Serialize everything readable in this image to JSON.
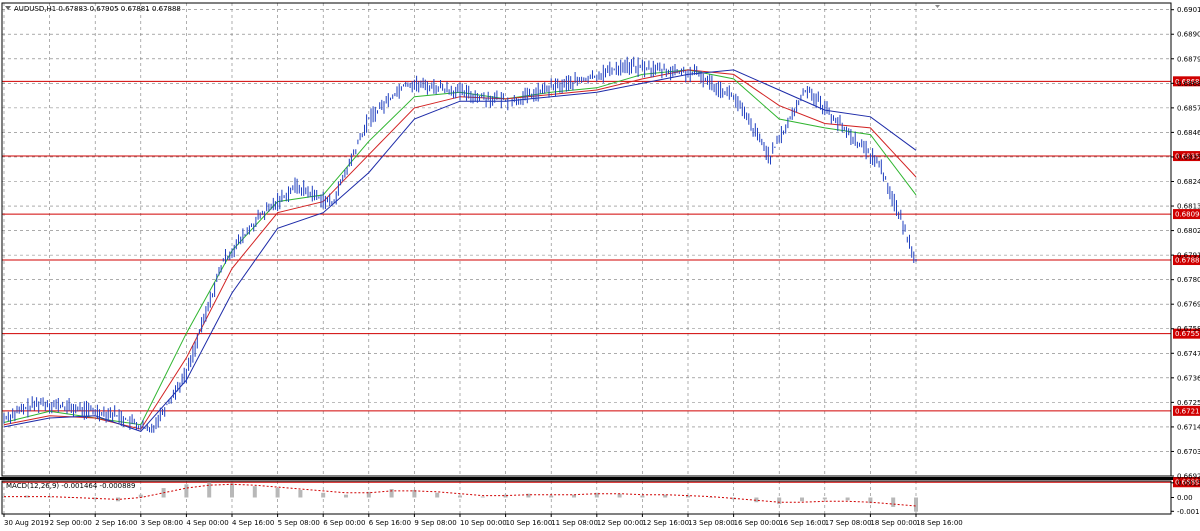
{
  "header": {
    "symbol_title": "AUDUSD,H1  0.67883 0.67905 0.67881 0.67888"
  },
  "macd_label": "MACD(12,26,9) -0.001464 -0.000889",
  "colors": {
    "price_line": "#1f3fbf",
    "ma_fast": "#2fb52f",
    "ma_mid": "#d22222",
    "ma_slow": "#1c2aa8",
    "level_line": "#d00000",
    "grid": "#7a7a7a",
    "macd_hist": "#b8b8b8",
    "macd_signal": "#d00000"
  },
  "chart_data": {
    "type": "line",
    "title": "AUDUSD,H1  0.67883 0.67905 0.67881 0.67888",
    "ylim": [
      0.6692,
      0.6904
    ],
    "y_ticks": [
      "0.69010",
      "0.68900",
      "0.68790",
      "0.68680",
      "0.68570",
      "0.68460",
      "0.68350",
      "0.68240",
      "0.68130",
      "0.68020",
      "0.67910",
      "0.67800",
      "0.67690",
      "0.67580",
      "0.67470",
      "0.67360",
      "0.67250",
      "0.67140",
      "0.67030",
      "0.66920"
    ],
    "x_labels": [
      "30 Aug 2019",
      "2 Sep 00:00",
      "2 Sep 16:00",
      "3 Sep 08:00",
      "4 Sep 00:00",
      "4 Sep 16:00",
      "5 Sep 08:00",
      "6 Sep 00:00",
      "6 Sep 16:00",
      "9 Sep 08:00",
      "10 Sep 00:00",
      "10 Sep 16:00",
      "11 Sep 08:00",
      "12 Sep 00:00",
      "12 Sep 16:00",
      "13 Sep 08:00",
      "16 Sep 00:00",
      "16 Sep 16:00",
      "17 Sep 08:00",
      "18 Sep 00:00",
      "18 Sep 16:00"
    ],
    "levels": [
      {
        "value": 0.68689,
        "label": "0.68689"
      },
      {
        "value": 0.68354,
        "label": "0.68354"
      },
      {
        "value": 0.68094,
        "label": "0.68094"
      },
      {
        "value": 0.67888,
        "label": "0.67888"
      },
      {
        "value": 0.67558,
        "label": "0.67558"
      },
      {
        "value": 0.67212,
        "label": "0.67212"
      },
      {
        "value": 0.66892,
        "label": "0.66892"
      }
    ],
    "series": [
      {
        "name": "AUDUSD",
        "x": [
          0.0,
          0.8,
          1.6,
          2.4,
          3.2,
          4.0,
          4.8,
          5.6,
          6.4,
          7.2,
          8.0,
          8.8,
          9.6,
          10.4,
          11.2,
          12.0,
          12.8,
          13.6,
          14.4,
          15.2,
          16.0,
          16.8,
          17.6,
          18.4,
          19.2,
          20.0
        ],
        "values": [
          0.6718,
          0.6725,
          0.6722,
          0.672,
          0.6712,
          0.6738,
          0.6788,
          0.6808,
          0.6822,
          0.6814,
          0.6852,
          0.6868,
          0.6866,
          0.6862,
          0.686,
          0.6866,
          0.687,
          0.6876,
          0.6874,
          0.6872,
          0.6862,
          0.6835,
          0.6866,
          0.6848,
          0.6832,
          0.6789
        ]
      },
      {
        "name": "MA fast",
        "x": [
          0,
          1,
          2,
          3,
          4,
          5,
          6,
          7,
          8,
          9,
          10,
          11,
          12,
          13,
          14,
          15,
          16,
          17,
          18,
          19,
          20
        ],
        "values": [
          0.6716,
          0.6721,
          0.6718,
          0.6715,
          0.6756,
          0.6793,
          0.6815,
          0.6818,
          0.6842,
          0.6862,
          0.6864,
          0.6861,
          0.6864,
          0.6866,
          0.6872,
          0.6874,
          0.687,
          0.6852,
          0.6848,
          0.6845,
          0.6818
        ]
      },
      {
        "name": "MA mid",
        "x": [
          0,
          1,
          2,
          3,
          4,
          5,
          6,
          7,
          8,
          9,
          10,
          11,
          12,
          13,
          14,
          15,
          16,
          17,
          18,
          19,
          20
        ],
        "values": [
          0.6715,
          0.6719,
          0.6718,
          0.6713,
          0.6745,
          0.6785,
          0.681,
          0.6815,
          0.6836,
          0.6857,
          0.6862,
          0.6861,
          0.6863,
          0.6865,
          0.687,
          0.6874,
          0.6872,
          0.6858,
          0.685,
          0.6848,
          0.6826
        ]
      },
      {
        "name": "MA slow",
        "x": [
          0,
          1,
          2,
          3,
          4,
          5,
          6,
          7,
          8,
          9,
          10,
          11,
          12,
          13,
          14,
          15,
          16,
          17,
          18,
          19,
          20
        ],
        "values": [
          0.6714,
          0.6718,
          0.6719,
          0.6712,
          0.6735,
          0.6774,
          0.6803,
          0.681,
          0.6828,
          0.6852,
          0.686,
          0.686,
          0.6862,
          0.6864,
          0.6868,
          0.6872,
          0.6874,
          0.6865,
          0.6856,
          0.6853,
          0.6838
        ]
      }
    ],
    "macd": {
      "x": [
        0.0,
        0.5,
        1.0,
        1.5,
        2.0,
        2.5,
        3.0,
        3.5,
        4.0,
        4.5,
        5.0,
        5.5,
        6.0,
        6.5,
        7.0,
        7.5,
        8.0,
        8.5,
        9.0,
        9.5,
        10.0,
        10.5,
        11.0,
        11.5,
        12.0,
        12.5,
        13.0,
        13.5,
        14.0,
        14.5,
        15.0,
        15.5,
        16.0,
        16.5,
        17.0,
        17.5,
        18.0,
        18.5,
        19.0,
        19.5,
        20.0
      ],
      "hist": [
        0.0001,
        0.0002,
        0.0001,
        0.0,
        -0.0002,
        -0.0004,
        0.0003,
        0.001,
        0.0014,
        0.0016,
        0.0015,
        0.0012,
        0.001,
        0.0008,
        0.0005,
        0.0003,
        0.0006,
        0.0009,
        0.0008,
        0.0005,
        0.0002,
        0.0001,
        0.0003,
        0.0004,
        0.0002,
        0.0003,
        0.0005,
        0.0004,
        0.0002,
        0.0003,
        0.0002,
        0.0,
        -0.0002,
        -0.0005,
        -0.0007,
        -0.0004,
        -0.0002,
        -0.0003,
        -0.0006,
        -0.001,
        -0.0015
      ],
      "signal": [
        0.0001,
        0.0001,
        0.0001,
        0.0,
        -0.0001,
        -0.0002,
        0.0,
        0.0005,
        0.001,
        0.0013,
        0.0014,
        0.0013,
        0.0011,
        0.0009,
        0.0007,
        0.0005,
        0.0005,
        0.0007,
        0.0007,
        0.0006,
        0.0004,
        0.0002,
        0.0002,
        0.0003,
        0.0003,
        0.0003,
        0.0004,
        0.0004,
        0.0003,
        0.0003,
        0.0002,
        0.0001,
        -0.0001,
        -0.0003,
        -0.0005,
        -0.0005,
        -0.0004,
        -0.0004,
        -0.0005,
        -0.0007,
        -0.0009
      ],
      "y_ticks": [
        "0.001559",
        "0.00",
        "-0.001464"
      ]
    }
  }
}
